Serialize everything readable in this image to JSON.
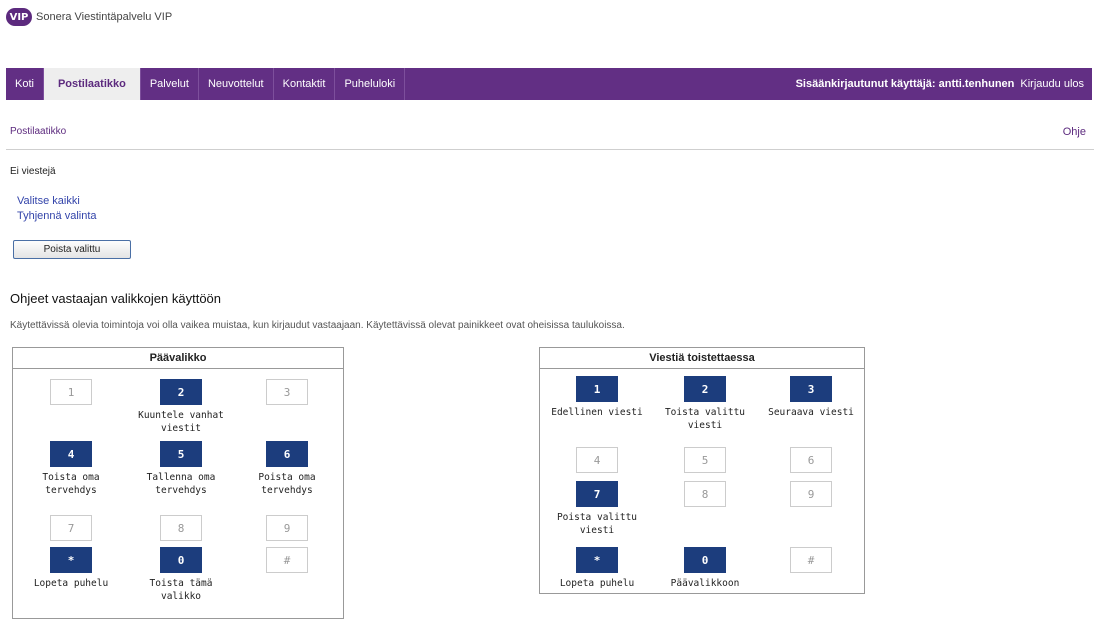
{
  "header": {
    "logo": "VIP",
    "app_name": "Sonera Viestintäpalvelu VIP"
  },
  "nav": {
    "items": [
      "Koti",
      "Postilaatikko",
      "Palvelut",
      "Neuvottelut",
      "Kontaktit",
      "Puheluloki"
    ],
    "active": "Postilaatikko",
    "user_text": "Sisäänkirjautunut käyttäjä: antti.tenhunen",
    "logout": "Kirjaudu ulos"
  },
  "breadcrumb": "Postilaatikko",
  "help": "Ohje",
  "mailbox": {
    "empty_text": "Ei viestejä",
    "select_all": "Valitse kaikki",
    "clear_selection": "Tyhjennä valinta",
    "delete_button": "Poista valittu"
  },
  "instructions": {
    "heading": "Ohjeet vastaajan valikkojen käyttöön",
    "text": "Käytettävissä olevia toimintoja voi olla vaikea muistaa, kun kirjaudut vastaajaan. Käytettävissä olevat painikkeet ovat oheisissa taulukoissa."
  },
  "main_menu": {
    "title": "Päävalikko",
    "keys": [
      {
        "key": "1",
        "active": false,
        "label": ""
      },
      {
        "key": "2",
        "active": true,
        "label": "Kuuntele vanhat viestit"
      },
      {
        "key": "3",
        "active": false,
        "label": ""
      },
      {
        "key": "4",
        "active": true,
        "label": "Toista oma tervehdys"
      },
      {
        "key": "5",
        "active": true,
        "label": "Tallenna oma tervehdys"
      },
      {
        "key": "6",
        "active": true,
        "label": "Poista oma tervehdys"
      },
      {
        "key": "7",
        "active": false,
        "label": ""
      },
      {
        "key": "8",
        "active": false,
        "label": ""
      },
      {
        "key": "9",
        "active": false,
        "label": ""
      },
      {
        "key": "*",
        "active": true,
        "label": "Lopeta puhelu"
      },
      {
        "key": "0",
        "active": true,
        "label": "Toista tämä valikko"
      },
      {
        "key": "#",
        "active": false,
        "label": ""
      }
    ]
  },
  "playback_menu": {
    "title": "Viestiä toistettaessa",
    "keys": [
      {
        "key": "1",
        "active": true,
        "label": "Edellinen viesti"
      },
      {
        "key": "2",
        "active": true,
        "label": "Toista valittu viesti"
      },
      {
        "key": "3",
        "active": true,
        "label": "Seuraava viesti"
      },
      {
        "key": "4",
        "active": false,
        "label": ""
      },
      {
        "key": "5",
        "active": false,
        "label": ""
      },
      {
        "key": "6",
        "active": false,
        "label": ""
      },
      {
        "key": "7",
        "active": true,
        "label": "Poista valittu viesti"
      },
      {
        "key": "8",
        "active": false,
        "label": ""
      },
      {
        "key": "9",
        "active": false,
        "label": ""
      },
      {
        "key": "*",
        "active": true,
        "label": "Lopeta puhelu"
      },
      {
        "key": "0",
        "active": true,
        "label": "Päävalikkoon"
      },
      {
        "key": "#",
        "active": false,
        "label": ""
      }
    ]
  }
}
